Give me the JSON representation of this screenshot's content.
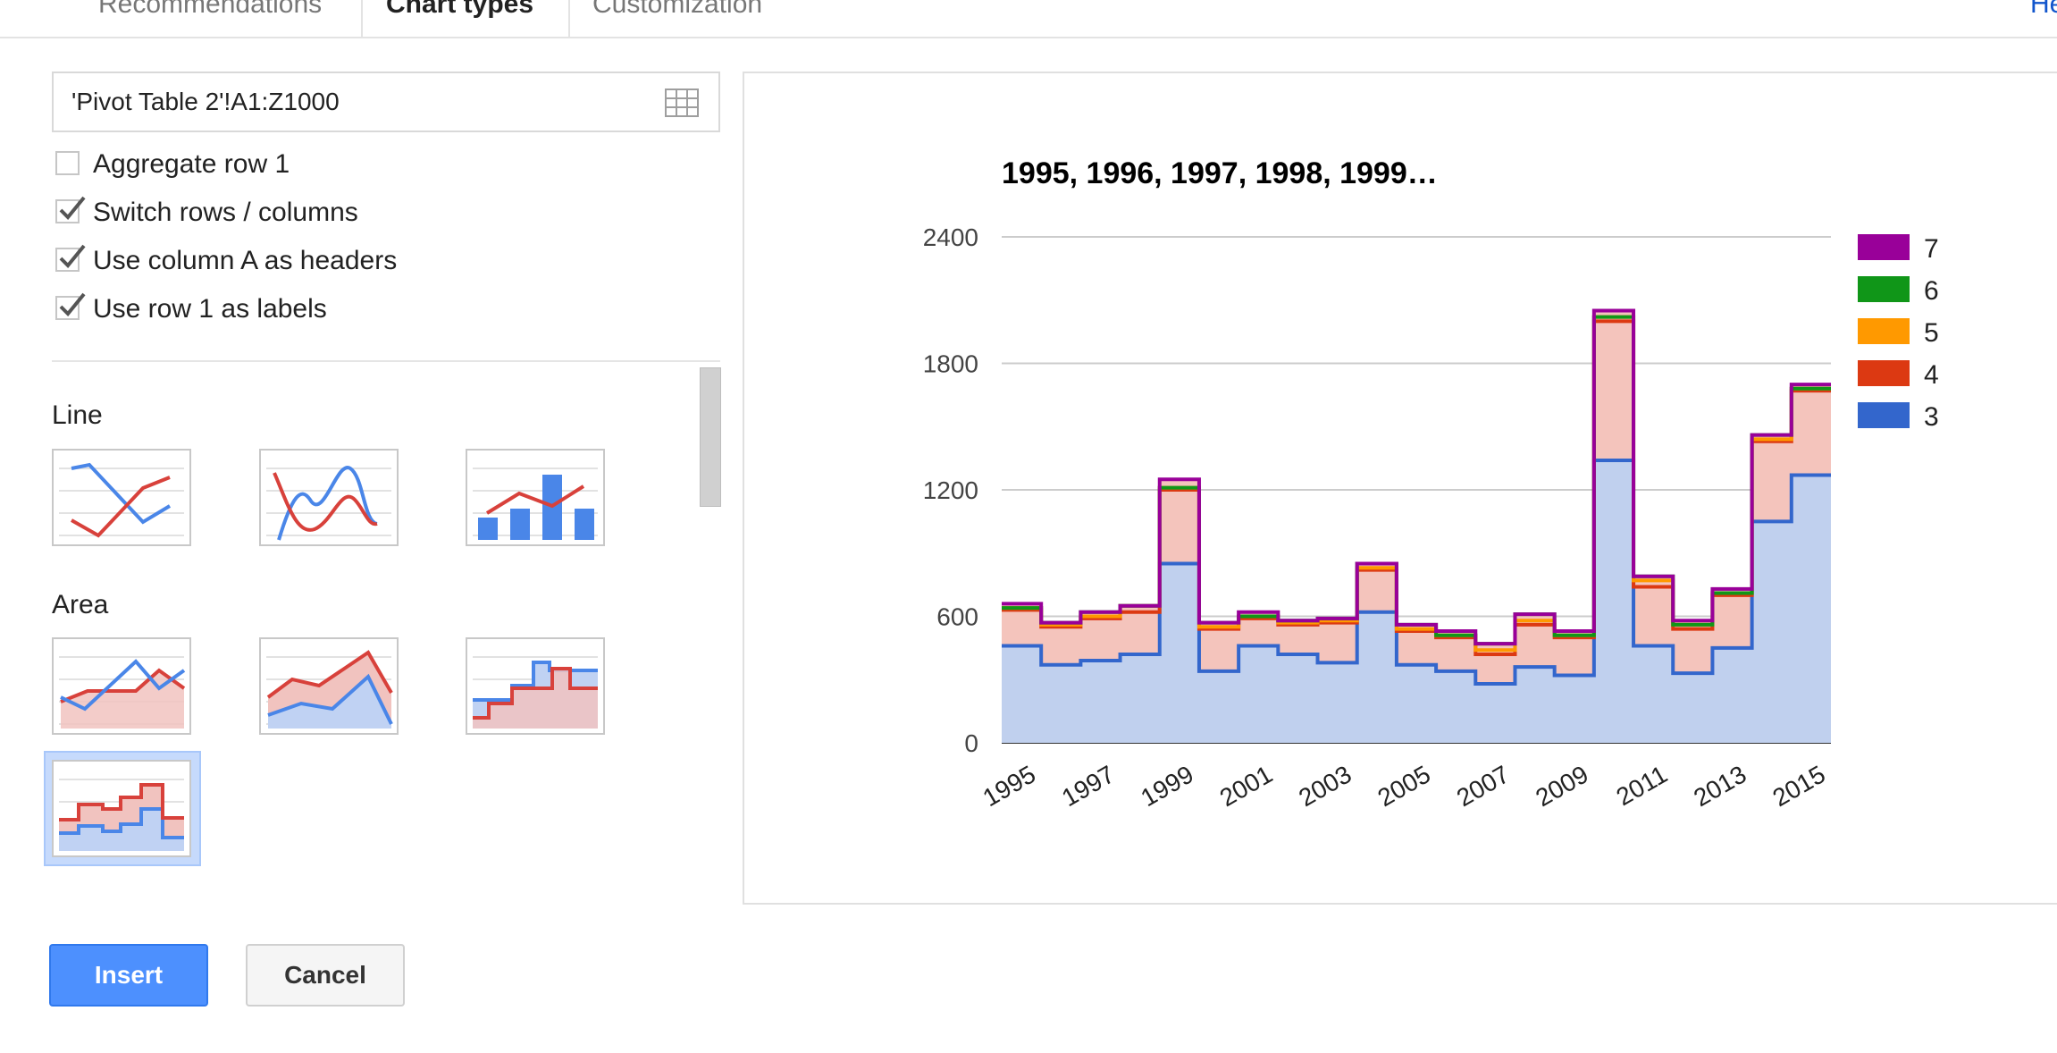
{
  "tabs": [
    "Recommendations",
    "Chart types",
    "Customization"
  ],
  "active_tab": "Chart types",
  "help_label": "Help",
  "data_range": "'Pivot Table 2'!A1:Z1000",
  "options": [
    {
      "label": "Aggregate row 1",
      "checked": false
    },
    {
      "label": "Switch rows / columns",
      "checked": true
    },
    {
      "label": "Use column A as headers",
      "checked": true
    },
    {
      "label": "Use row 1 as labels",
      "checked": true
    }
  ],
  "sections": {
    "line": "Line",
    "area": "Area"
  },
  "thumbnails": {
    "line": [
      "line-chart",
      "smooth-line-chart",
      "combo-chart"
    ],
    "area": [
      "area-chart",
      "stacked-area-chart",
      "stepped-area-chart",
      "stacked-stepped-area-chart"
    ],
    "selected": "stacked-stepped-area-chart"
  },
  "buttons": {
    "insert": "Insert",
    "cancel": "Cancel"
  },
  "colors": {
    "accent": "#4d90fe",
    "link": "#1155cc",
    "selected_bg": "#c6dafc"
  },
  "chart_data": {
    "type": "area",
    "style": "stacked-stepped",
    "title": "1995, 1996, 1997, 1998, 1999…",
    "xlabel": "",
    "ylabel": "",
    "categories": [
      "1995",
      "1996",
      "1997",
      "1998",
      "1999",
      "2000",
      "2001",
      "2002",
      "2003",
      "2004",
      "2005",
      "2006",
      "2007",
      "2008",
      "2009",
      "2010",
      "2011",
      "2012",
      "2013",
      "2014",
      "2015"
    ],
    "x_tick_labels": [
      "1995",
      "1997",
      "1999",
      "2001",
      "2003",
      "2005",
      "2007",
      "2009",
      "2011",
      "2013",
      "2015"
    ],
    "y_ticks": [
      0,
      600,
      1200,
      1800,
      2400
    ],
    "ylim": [
      0,
      2400
    ],
    "grid": true,
    "legend_position": "right",
    "series": [
      {
        "name": "3",
        "color": "#3366cc",
        "fill": "#c0d0ee",
        "values": [
          460,
          370,
          390,
          420,
          850,
          340,
          460,
          420,
          380,
          620,
          370,
          340,
          280,
          360,
          320,
          1340,
          460,
          330,
          450,
          1050,
          1270
        ]
      },
      {
        "name": "4",
        "color": "#dc3912",
        "fill": "#f4c4bc",
        "values": [
          170,
          180,
          200,
          200,
          350,
          200,
          130,
          140,
          190,
          200,
          160,
          160,
          140,
          200,
          180,
          660,
          280,
          210,
          250,
          380,
          400
        ]
      },
      {
        "name": "5",
        "color": "#ff9900",
        "fill": "#f4c4bc",
        "values": [
          10,
          10,
          10,
          30,
          10,
          10,
          10,
          10,
          10,
          10,
          10,
          10,
          20,
          20,
          10,
          20,
          30,
          20,
          10,
          10,
          10
        ]
      },
      {
        "name": "6",
        "color": "#109618",
        "fill": "#f4c4bc",
        "values": [
          0,
          10,
          20,
          0,
          0,
          20,
          0,
          10,
          10,
          20,
          20,
          0,
          30,
          30,
          0,
          0,
          20,
          0,
          0,
          20,
          0
        ]
      },
      {
        "name": "7",
        "color": "#990099",
        "fill": "#f4c4bc",
        "values": [
          20,
          0,
          0,
          0,
          40,
          0,
          20,
          0,
          0,
          0,
          0,
          20,
          0,
          0,
          20,
          30,
          0,
          20,
          20,
          0,
          20
        ]
      }
    ]
  }
}
